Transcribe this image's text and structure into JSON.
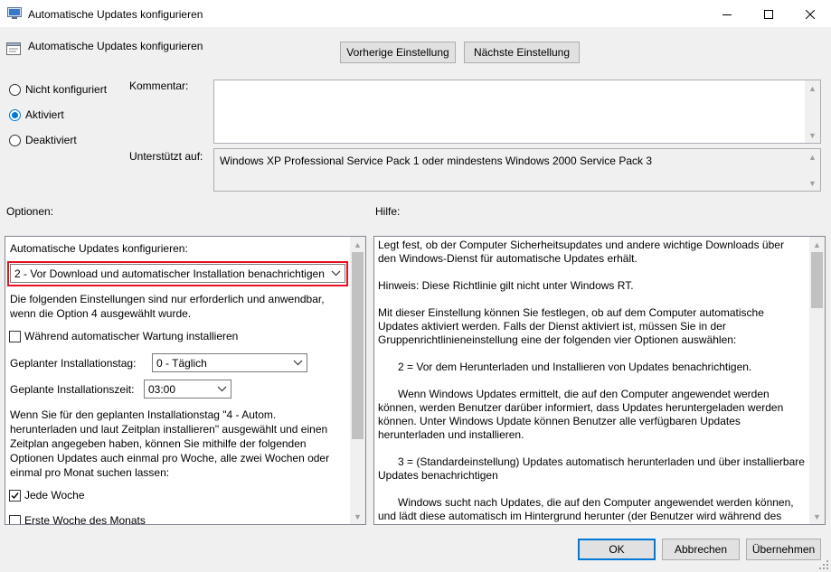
{
  "window": {
    "title": "Automatische Updates konfigurieren",
    "minimize_icon": "minimize-icon",
    "maximize_icon": "maximize-icon",
    "close_icon": "close-icon"
  },
  "header": {
    "policy_name": "Automatische Updates konfigurieren",
    "prev_button": "Vorherige Einstellung",
    "next_button": "Nächste Einstellung"
  },
  "state": {
    "options": [
      {
        "label": "Nicht konfiguriert",
        "selected": false
      },
      {
        "label": "Aktiviert",
        "selected": true
      },
      {
        "label": "Deaktiviert",
        "selected": false
      }
    ]
  },
  "comment": {
    "label": "Kommentar:",
    "value": ""
  },
  "supported": {
    "label": "Unterstützt auf:",
    "value": "Windows XP Professional Service Pack 1 oder mindestens Windows 2000 Service Pack 3"
  },
  "options_section": {
    "label": "Optionen:",
    "configure_label": "Automatische Updates konfigurieren:",
    "configure_value": "2 - Vor Download und automatischer Installation benachrichtigen",
    "note": "Die folgenden Einstellungen sind nur erforderlich und anwendbar, wenn die Option 4 ausgewählt wurde.",
    "maintenance_checkbox": {
      "label": "Während automatischer Wartung installieren",
      "checked": false
    },
    "install_day_label": "Geplanter Installationstag:",
    "install_day_value": "0 - Täglich",
    "install_time_label": "Geplante Installationszeit:",
    "install_time_value": "03:00",
    "schedule_note": "Wenn Sie für den geplanten Installationstag \"4 - Autom. herunterladen und laut Zeitplan installieren\" ausgewählt und einen Zeitplan angegeben haben, können Sie mithilfe der folgenden Optionen Updates auch einmal pro Woche, alle zwei Wochen oder einmal pro Monat suchen lassen:",
    "every_week": {
      "label": "Jede Woche",
      "checked": true
    },
    "first_week": {
      "label": "Erste Woche des Monats",
      "checked": false
    }
  },
  "help_section": {
    "label": "Hilfe:",
    "paragraphs": [
      "Legt fest, ob der Computer Sicherheitsupdates und andere wichtige Downloads über den Windows-Dienst für automatische Updates erhält.",
      "Hinweis: Diese Richtlinie gilt nicht unter Windows RT.",
      "Mit dieser Einstellung können Sie festlegen, ob auf dem Computer automatische Updates aktiviert werden. Falls der Dienst aktiviert ist, müssen Sie in der Gruppenrichtlinieneinstellung eine der folgenden vier Optionen auswählen:",
      "2 = Vor dem Herunterladen und Installieren von Updates benachrichtigen.",
      "Wenn Windows Updates ermittelt, die auf den Computer angewendet werden können, werden Benutzer darüber informiert, dass Updates heruntergeladen werden können. Unter Windows Update können Benutzer alle verfügbaren Updates herunterladen und installieren.",
      "3 = (Standardeinstellung) Updates automatisch herunterladen und über installierbare Updates benachrichtigen",
      "Windows sucht nach Updates, die auf den Computer angewendet werden können, und lädt diese automatisch im Hintergrund herunter (der Benutzer wird während des"
    ]
  },
  "footer": {
    "ok": "OK",
    "cancel": "Abbrechen",
    "apply": "Übernehmen"
  },
  "colors": {
    "accent": "#0078d7",
    "highlight_border": "#e81123"
  }
}
